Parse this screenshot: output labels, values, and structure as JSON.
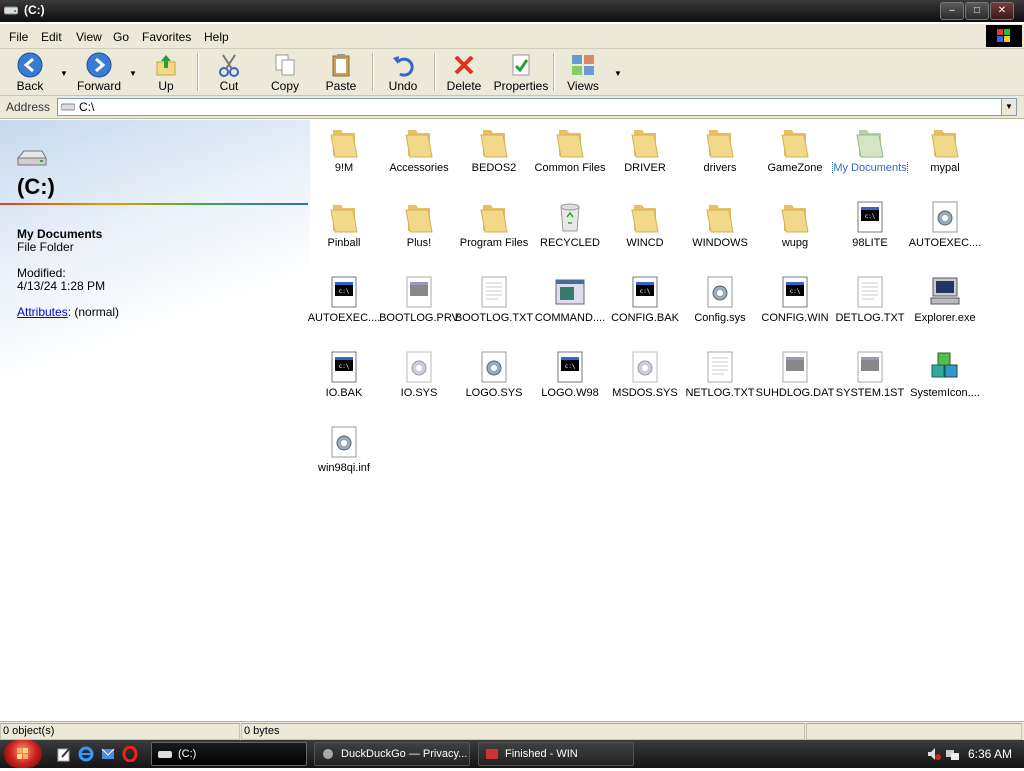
{
  "window": {
    "title": "(C:)"
  },
  "menu": [
    "File",
    "Edit",
    "View",
    "Go",
    "Favorites",
    "Help"
  ],
  "toolbar": {
    "back": "Back",
    "forward": "Forward",
    "up": "Up",
    "cut": "Cut",
    "copy": "Copy",
    "paste": "Paste",
    "undo": "Undo",
    "delete": "Delete",
    "properties": "Properties",
    "views": "Views"
  },
  "address": {
    "label": "Address",
    "value": "C:\\"
  },
  "leftpane": {
    "title": "(C:)",
    "selected_name": "My Documents",
    "selected_type": "File Folder",
    "modified_label": "Modified:",
    "modified_value": "4/13/24 1:28 PM",
    "attributes_link": "Attributes",
    "attributes_value": ": (normal)"
  },
  "files": [
    {
      "name": "9!M",
      "icon": "folder"
    },
    {
      "name": "Accessories",
      "icon": "folder"
    },
    {
      "name": "BEDOS2",
      "icon": "folder"
    },
    {
      "name": "Common Files",
      "icon": "folder"
    },
    {
      "name": "DRIVER",
      "icon": "folder"
    },
    {
      "name": "drivers",
      "icon": "folder"
    },
    {
      "name": "GameZone",
      "icon": "folder"
    },
    {
      "name": "My Documents",
      "icon": "folder-special",
      "selected": true
    },
    {
      "name": "mypal",
      "icon": "folder"
    },
    {
      "name": "Pinball",
      "icon": "folder"
    },
    {
      "name": "Plus!",
      "icon": "folder"
    },
    {
      "name": "Program Files",
      "icon": "folder"
    },
    {
      "name": "RECYCLED",
      "icon": "recycle-bin"
    },
    {
      "name": "WINCD",
      "icon": "folder"
    },
    {
      "name": "WINDOWS",
      "icon": "folder"
    },
    {
      "name": "wupg",
      "icon": "folder"
    },
    {
      "name": "98LITE",
      "icon": "ms-dos"
    },
    {
      "name": "AUTOEXEC....",
      "icon": "gear-doc"
    },
    {
      "name": "AUTOEXEC....",
      "icon": "ms-dos"
    },
    {
      "name": "BOOTLOG.PRV",
      "icon": "ms-dos-light"
    },
    {
      "name": "BOOTLOG.TXT",
      "icon": "text-doc"
    },
    {
      "name": "COMMAND....",
      "icon": "app-window"
    },
    {
      "name": "CONFIG.BAK",
      "icon": "ms-dos"
    },
    {
      "name": "Config.sys",
      "icon": "gear-doc"
    },
    {
      "name": "CONFIG.WIN",
      "icon": "ms-dos"
    },
    {
      "name": "DETLOG.TXT",
      "icon": "text-doc"
    },
    {
      "name": "Explorer.exe",
      "icon": "computer"
    },
    {
      "name": "IO.BAK",
      "icon": "ms-dos"
    },
    {
      "name": "IO.SYS",
      "icon": "gear-doc-light"
    },
    {
      "name": "LOGO.SYS",
      "icon": "gear-doc"
    },
    {
      "name": "LOGO.W98",
      "icon": "ms-dos"
    },
    {
      "name": "MSDOS.SYS",
      "icon": "gear-doc-light"
    },
    {
      "name": "NETLOG.TXT",
      "icon": "text-doc"
    },
    {
      "name": "SUHDLOG.DAT",
      "icon": "ms-dos-light"
    },
    {
      "name": "SYSTEM.1ST",
      "icon": "ms-dos-light"
    },
    {
      "name": "SystemIcon....",
      "icon": "cubes"
    },
    {
      "name": "win98qi.inf",
      "icon": "gear-doc"
    }
  ],
  "status": {
    "objects": "0 object(s)",
    "size": "0 bytes"
  },
  "taskbar": {
    "tasks": [
      "(C:)",
      "DuckDuckGo — Privacy...",
      "Finished - WIN"
    ],
    "clock": "6:36 AM"
  },
  "colors": {
    "folder": "#f2d98a",
    "selection": "#316ac5",
    "chrome": "#ece9d8"
  }
}
